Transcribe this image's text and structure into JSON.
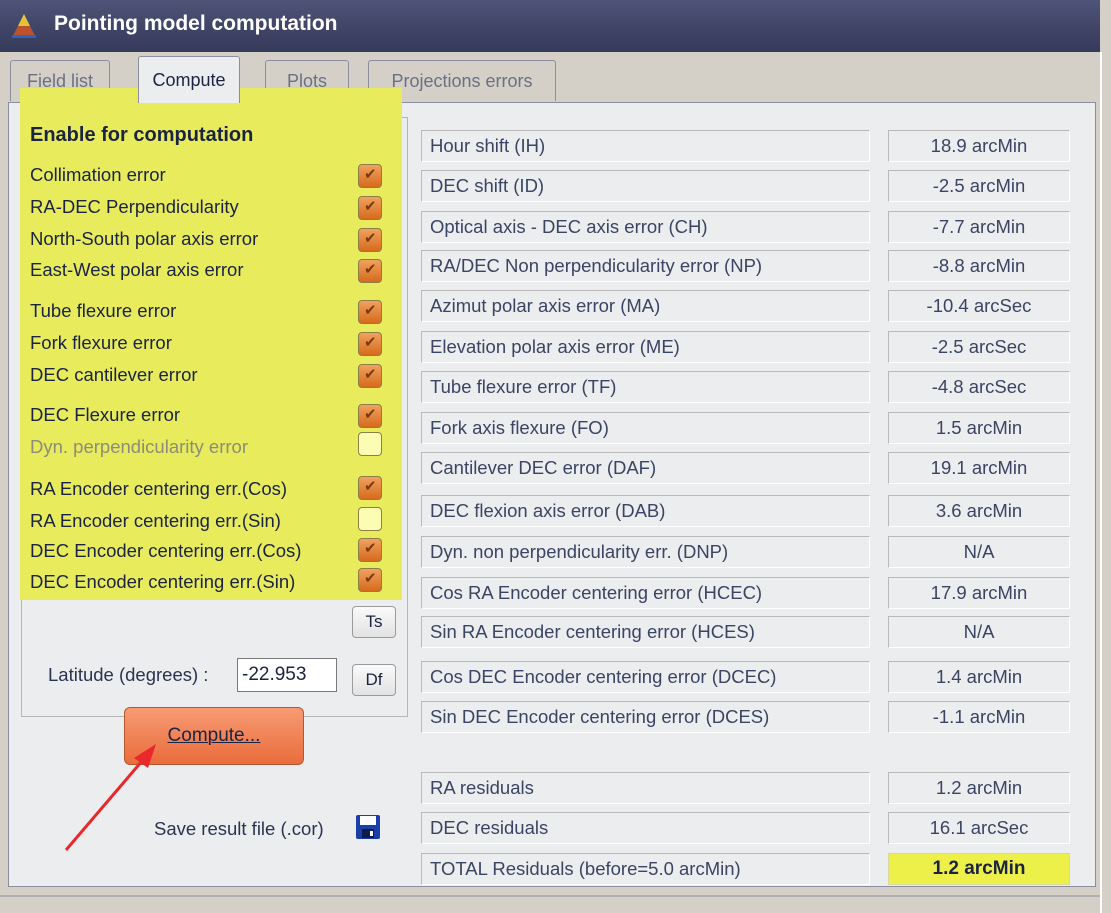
{
  "window": {
    "title": "Pointing model computation"
  },
  "tabs": [
    {
      "label": "Field list"
    },
    {
      "label": "Compute"
    },
    {
      "label": "Plots"
    },
    {
      "label": "Projections errors"
    }
  ],
  "enable": {
    "title": "Enable for computation",
    "items": [
      {
        "label": "Collimation error",
        "checked": true
      },
      {
        "label": "RA-DEC Perpendicularity",
        "checked": true
      },
      {
        "label": "North-South polar axis error",
        "checked": true
      },
      {
        "label": "East-West polar axis error",
        "checked": true
      },
      {
        "label": "Tube flexure error",
        "checked": true
      },
      {
        "label": "Fork flexure error",
        "checked": true
      },
      {
        "label": "DEC cantilever error",
        "checked": true
      },
      {
        "label": "DEC Flexure error",
        "checked": true
      },
      {
        "label": "Dyn. perpendicularity error",
        "checked": false
      },
      {
        "label": "RA Encoder centering err.(Cos)",
        "checked": true
      },
      {
        "label": "RA Encoder centering err.(Sin)",
        "checked": false
      },
      {
        "label": "DEC Encoder centering err.(Cos)",
        "checked": true
      },
      {
        "label": "DEC Encoder centering err.(Sin)",
        "checked": true
      }
    ]
  },
  "buttons": {
    "ts": "Ts",
    "df": "Df",
    "compute": "Compute..."
  },
  "latitude": {
    "label": "Latitude (degrees) :",
    "value": "-22.953"
  },
  "save": {
    "label": "Save result file (.cor)"
  },
  "results": [
    {
      "label": "Hour shift (IH)",
      "value": "18.9 arcMin"
    },
    {
      "label": "DEC shift (ID)",
      "value": "-2.5 arcMin"
    },
    {
      "label": "Optical axis - DEC axis error (CH)",
      "value": "-7.7 arcMin"
    },
    {
      "label": "RA/DEC Non perpendicularity error (NP)",
      "value": "-8.8 arcMin"
    },
    {
      "label": "Azimut polar axis error (MA)",
      "value": "-10.4 arcSec"
    },
    {
      "label": "Elevation polar axis error (ME)",
      "value": "-2.5 arcSec"
    },
    {
      "label": "Tube flexure error (TF)",
      "value": "-4.8 arcSec"
    },
    {
      "label": "Fork axis flexure (FO)",
      "value": "1.5 arcMin"
    },
    {
      "label": "Cantilever DEC error (DAF)",
      "value": "19.1 arcMin"
    },
    {
      "label": "DEC flexion axis error (DAB)",
      "value": "3.6 arcMin"
    },
    {
      "label": "Dyn. non perpendicularity err. (DNP)",
      "value": "N/A"
    },
    {
      "label": "Cos RA Encoder centering error (HCEC)",
      "value": "17.9 arcMin"
    },
    {
      "label": "Sin RA Encoder centering error (HCES)",
      "value": "N/A"
    },
    {
      "label": "Cos DEC Encoder centering error (DCEC)",
      "value": "1.4 arcMin"
    },
    {
      "label": "Sin DEC Encoder centering error (DCES)",
      "value": "-1.1 arcMin"
    }
  ],
  "residuals": [
    {
      "label": "RA residuals",
      "value": "1.2 arcMin"
    },
    {
      "label": "DEC residuals",
      "value": "16.1 arcSec"
    },
    {
      "label": "TOTAL Residuals (before=5.0 arcMin)",
      "value": "1.2 arcMin"
    }
  ],
  "colors": {
    "highlight": "#e8ec5c",
    "checkbox_on": "#e27a33",
    "compute_button": "#f0815a",
    "annotation_arrow": "#e8282a"
  }
}
